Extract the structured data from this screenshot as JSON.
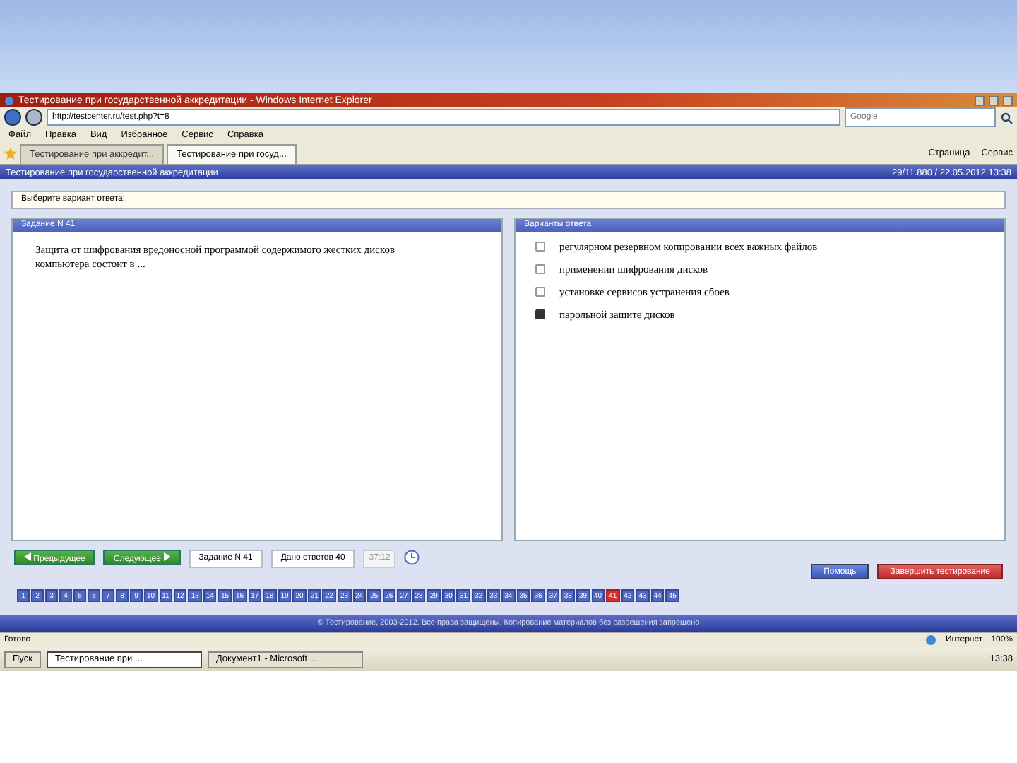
{
  "window": {
    "title": "Тестирование при государственной аккредитации - Windows Internet Explorer"
  },
  "address_bar": {
    "url": "http://testcenter.ru/test.php?t=8",
    "search_placeholder": "Google"
  },
  "menu": [
    "Файл",
    "Правка",
    "Вид",
    "Избранное",
    "Сервис",
    "Справка"
  ],
  "tabs": [
    {
      "label": "Тестирование при аккредит...",
      "selected": false
    },
    {
      "label": "Тестирование при госуд...",
      "selected": true
    }
  ],
  "command_bar": [
    "Страница",
    "Сервис"
  ],
  "page_header": {
    "title": "Тестирование при государственной аккредитации",
    "session": "29/11.880 / 22.05.2012 13:38"
  },
  "notice": "Выберите вариант ответа!",
  "question": {
    "header": "Задание N 41",
    "text": "Защита от шифрования вредоносной программой содержимого жестких дисков компьютера состоит в ..."
  },
  "answers": {
    "header": "Варианты ответа",
    "options": [
      {
        "label": "регулярном резервном копировании всех важных файлов",
        "selected": false
      },
      {
        "label": "применении шифрования дисков",
        "selected": false
      },
      {
        "label": "установке сервисов устранения сбоев",
        "selected": false
      },
      {
        "label": "парольной защите дисков",
        "selected": true
      }
    ]
  },
  "controls": {
    "prev": "Предыдущее",
    "next": "Следующее",
    "task": "Задание N 41",
    "answered": "Дано ответов 40",
    "timer": "37:12",
    "help": "Помощь",
    "finish": "Завершить тестирование"
  },
  "question_numbers": [
    {
      "label": "1",
      "selected": false
    },
    {
      "label": "2",
      "selected": false
    },
    {
      "label": "3",
      "selected": false
    },
    {
      "label": "4",
      "selected": false
    },
    {
      "label": "5",
      "selected": false
    },
    {
      "label": "6",
      "selected": false
    },
    {
      "label": "7",
      "selected": false
    },
    {
      "label": "8",
      "selected": false
    },
    {
      "label": "9",
      "selected": false
    },
    {
      "label": "10",
      "selected": false
    },
    {
      "label": "11",
      "selected": false
    },
    {
      "label": "12",
      "selected": false
    },
    {
      "label": "13",
      "selected": false
    },
    {
      "label": "14",
      "selected": false
    },
    {
      "label": "15",
      "selected": false
    },
    {
      "label": "16",
      "selected": false
    },
    {
      "label": "17",
      "selected": false
    },
    {
      "label": "18",
      "selected": false
    },
    {
      "label": "19",
      "selected": false
    },
    {
      "label": "20",
      "selected": false
    },
    {
      "label": "21",
      "selected": false
    },
    {
      "label": "22",
      "selected": false
    },
    {
      "label": "23",
      "selected": false
    },
    {
      "label": "24",
      "selected": false
    },
    {
      "label": "25",
      "selected": false
    },
    {
      "label": "26",
      "selected": false
    },
    {
      "label": "27",
      "selected": false
    },
    {
      "label": "28",
      "selected": false
    },
    {
      "label": "29",
      "selected": false
    },
    {
      "label": "30",
      "selected": false
    },
    {
      "label": "31",
      "selected": false
    },
    {
      "label": "32",
      "selected": false
    },
    {
      "label": "33",
      "selected": false
    },
    {
      "label": "34",
      "selected": false
    },
    {
      "label": "35",
      "selected": false
    },
    {
      "label": "36",
      "selected": false
    },
    {
      "label": "37",
      "selected": false
    },
    {
      "label": "38",
      "selected": false
    },
    {
      "label": "39",
      "selected": false
    },
    {
      "label": "40",
      "selected": false
    },
    {
      "label": "41",
      "selected": true
    },
    {
      "label": "42",
      "selected": false
    },
    {
      "label": "43",
      "selected": false
    },
    {
      "label": "44",
      "selected": false
    },
    {
      "label": "45",
      "selected": false
    }
  ],
  "footer": "© Тестирование, 2003-2012. Все права защищены. Копирование материалов без разрешения запрещено",
  "status_bar": {
    "text": "Готово",
    "zone": "Интернет",
    "zoom": "100%"
  },
  "taskbar": {
    "start": "Пуск",
    "tasks": [
      {
        "label": "Тестирование при ...",
        "selected": true
      },
      {
        "label": "Документ1 - Microsoft ...",
        "selected": false
      }
    ],
    "clock": "13:38"
  }
}
